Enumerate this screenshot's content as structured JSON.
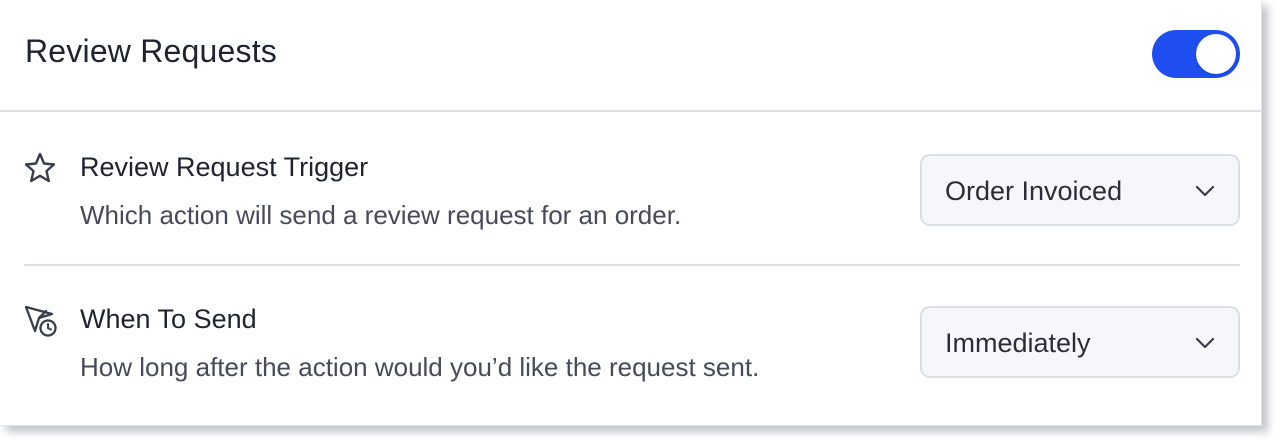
{
  "header": {
    "title": "Review Requests",
    "toggle_on": true
  },
  "rows": [
    {
      "icon": "star-icon",
      "title": "Review Request Trigger",
      "description": "Which action will send a review request for an order.",
      "selected": "Order Invoiced"
    },
    {
      "icon": "send-clock-icon",
      "title": "When To Send",
      "description": "How long after the action would you’d like the request sent.",
      "selected": "Immediately"
    }
  ],
  "colors": {
    "accent": "#1f4ef0",
    "text": "#1f2230",
    "muted": "#474a5a",
    "border": "#dcdee7",
    "select_bg": "#f6f7fb"
  }
}
